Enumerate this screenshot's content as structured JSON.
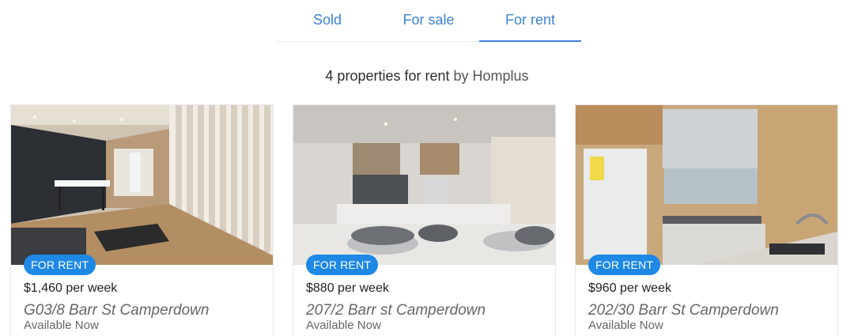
{
  "tabs": [
    {
      "label": "Sold",
      "active": false
    },
    {
      "label": "For sale",
      "active": false
    },
    {
      "label": "For rent",
      "active": true
    }
  ],
  "heading": {
    "count_text": "4 properties for rent",
    "by_text": "by Homplus"
  },
  "colors": {
    "accent": "#1e88e5",
    "tab_text": "#3b82d6"
  },
  "listings": [
    {
      "badge": "FOR RENT",
      "price": "$1,460 per week",
      "address": "G03/8 Barr St Camperdown",
      "availability": "Available Now"
    },
    {
      "badge": "FOR RENT",
      "price": "$880 per week",
      "address": "207/2 Barr st Camperdown",
      "availability": "Available Now"
    },
    {
      "badge": "FOR RENT",
      "price": "$960 per week",
      "address": "202/30 Barr St Camperdown",
      "availability": "Available Now"
    }
  ]
}
